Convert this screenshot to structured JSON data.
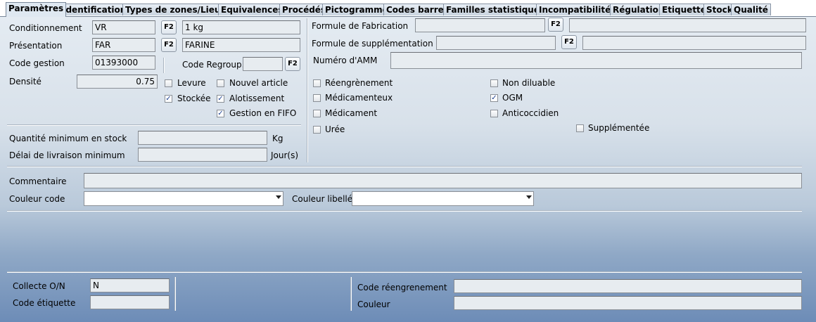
{
  "tabs": [
    {
      "label": "Paramètres",
      "active": true
    },
    {
      "label": "Identification"
    },
    {
      "label": "Types de zones/Lieux"
    },
    {
      "label": "Equivalences"
    },
    {
      "label": "Procédés"
    },
    {
      "label": "Pictogramme"
    },
    {
      "label": "Codes barres"
    },
    {
      "label": "Familles statistiques"
    },
    {
      "label": "Incompatibilités"
    },
    {
      "label": "Régulation"
    },
    {
      "label": "Etiquette"
    },
    {
      "label": "Stock"
    },
    {
      "label": "Qualité"
    }
  ],
  "f2_label": "F2",
  "left": {
    "conditionnement": {
      "label": "Conditionnement",
      "code": "VR",
      "desc": "1 kg"
    },
    "presentation": {
      "label": "Présentation",
      "code": "FAR",
      "desc": "FARINE"
    },
    "code_gestion": {
      "label": "Code gestion",
      "value": "01393000"
    },
    "code_regroup": {
      "label": "Code Regroup.",
      "value": ""
    },
    "densite": {
      "label": "Densité",
      "value": "0.75"
    },
    "checks": {
      "levure": {
        "label": "Levure",
        "checked": false
      },
      "nouvel_article": {
        "label": "Nouvel article",
        "checked": false
      },
      "stockee": {
        "label": "Stockée",
        "checked": true
      },
      "alotissement": {
        "label": "Alotissement",
        "checked": true
      },
      "fifo": {
        "label": "Gestion en FIFO",
        "checked": true
      }
    },
    "qte_min": {
      "label": "Quantité minimum en stock",
      "value": "",
      "unit": "Kg"
    },
    "delai": {
      "label": "Délai de livraison minimum",
      "value": "",
      "unit": "Jour(s)"
    }
  },
  "right": {
    "formule_fab": {
      "label": "Formule de Fabrication",
      "value": "",
      "desc": ""
    },
    "formule_sup": {
      "label": "Formule de supplémentation",
      "value": "",
      "desc": ""
    },
    "amm": {
      "label": "Numéro d'AMM",
      "value": ""
    },
    "checks": {
      "reengrenement": {
        "label": "Réengrènement",
        "checked": false
      },
      "non_diluable": {
        "label": "Non diluable",
        "checked": false
      },
      "medicamenteux": {
        "label": "Médicamenteux",
        "checked": false
      },
      "ogm": {
        "label": "OGM",
        "checked": true
      },
      "medicament": {
        "label": "Médicament",
        "checked": false
      },
      "anticoccidien": {
        "label": "Anticoccidien",
        "checked": false
      },
      "uree": {
        "label": "Urée",
        "checked": false
      },
      "supplementee": {
        "label": "Supplémentée",
        "checked": false
      }
    }
  },
  "commentaire": {
    "label": "Commentaire",
    "value": ""
  },
  "couleur_code": {
    "label": "Couleur code",
    "value": ""
  },
  "couleur_libelle": {
    "label": "Couleur libellé",
    "value": ""
  },
  "bottom": {
    "collecte": {
      "label": "Collecte O/N",
      "value": "N"
    },
    "code_etiquette": {
      "label": "Code étiquette",
      "value": ""
    },
    "code_reengrenement": {
      "label": "Code réengrenement",
      "value": ""
    },
    "couleur": {
      "label": "Couleur",
      "value": ""
    }
  }
}
